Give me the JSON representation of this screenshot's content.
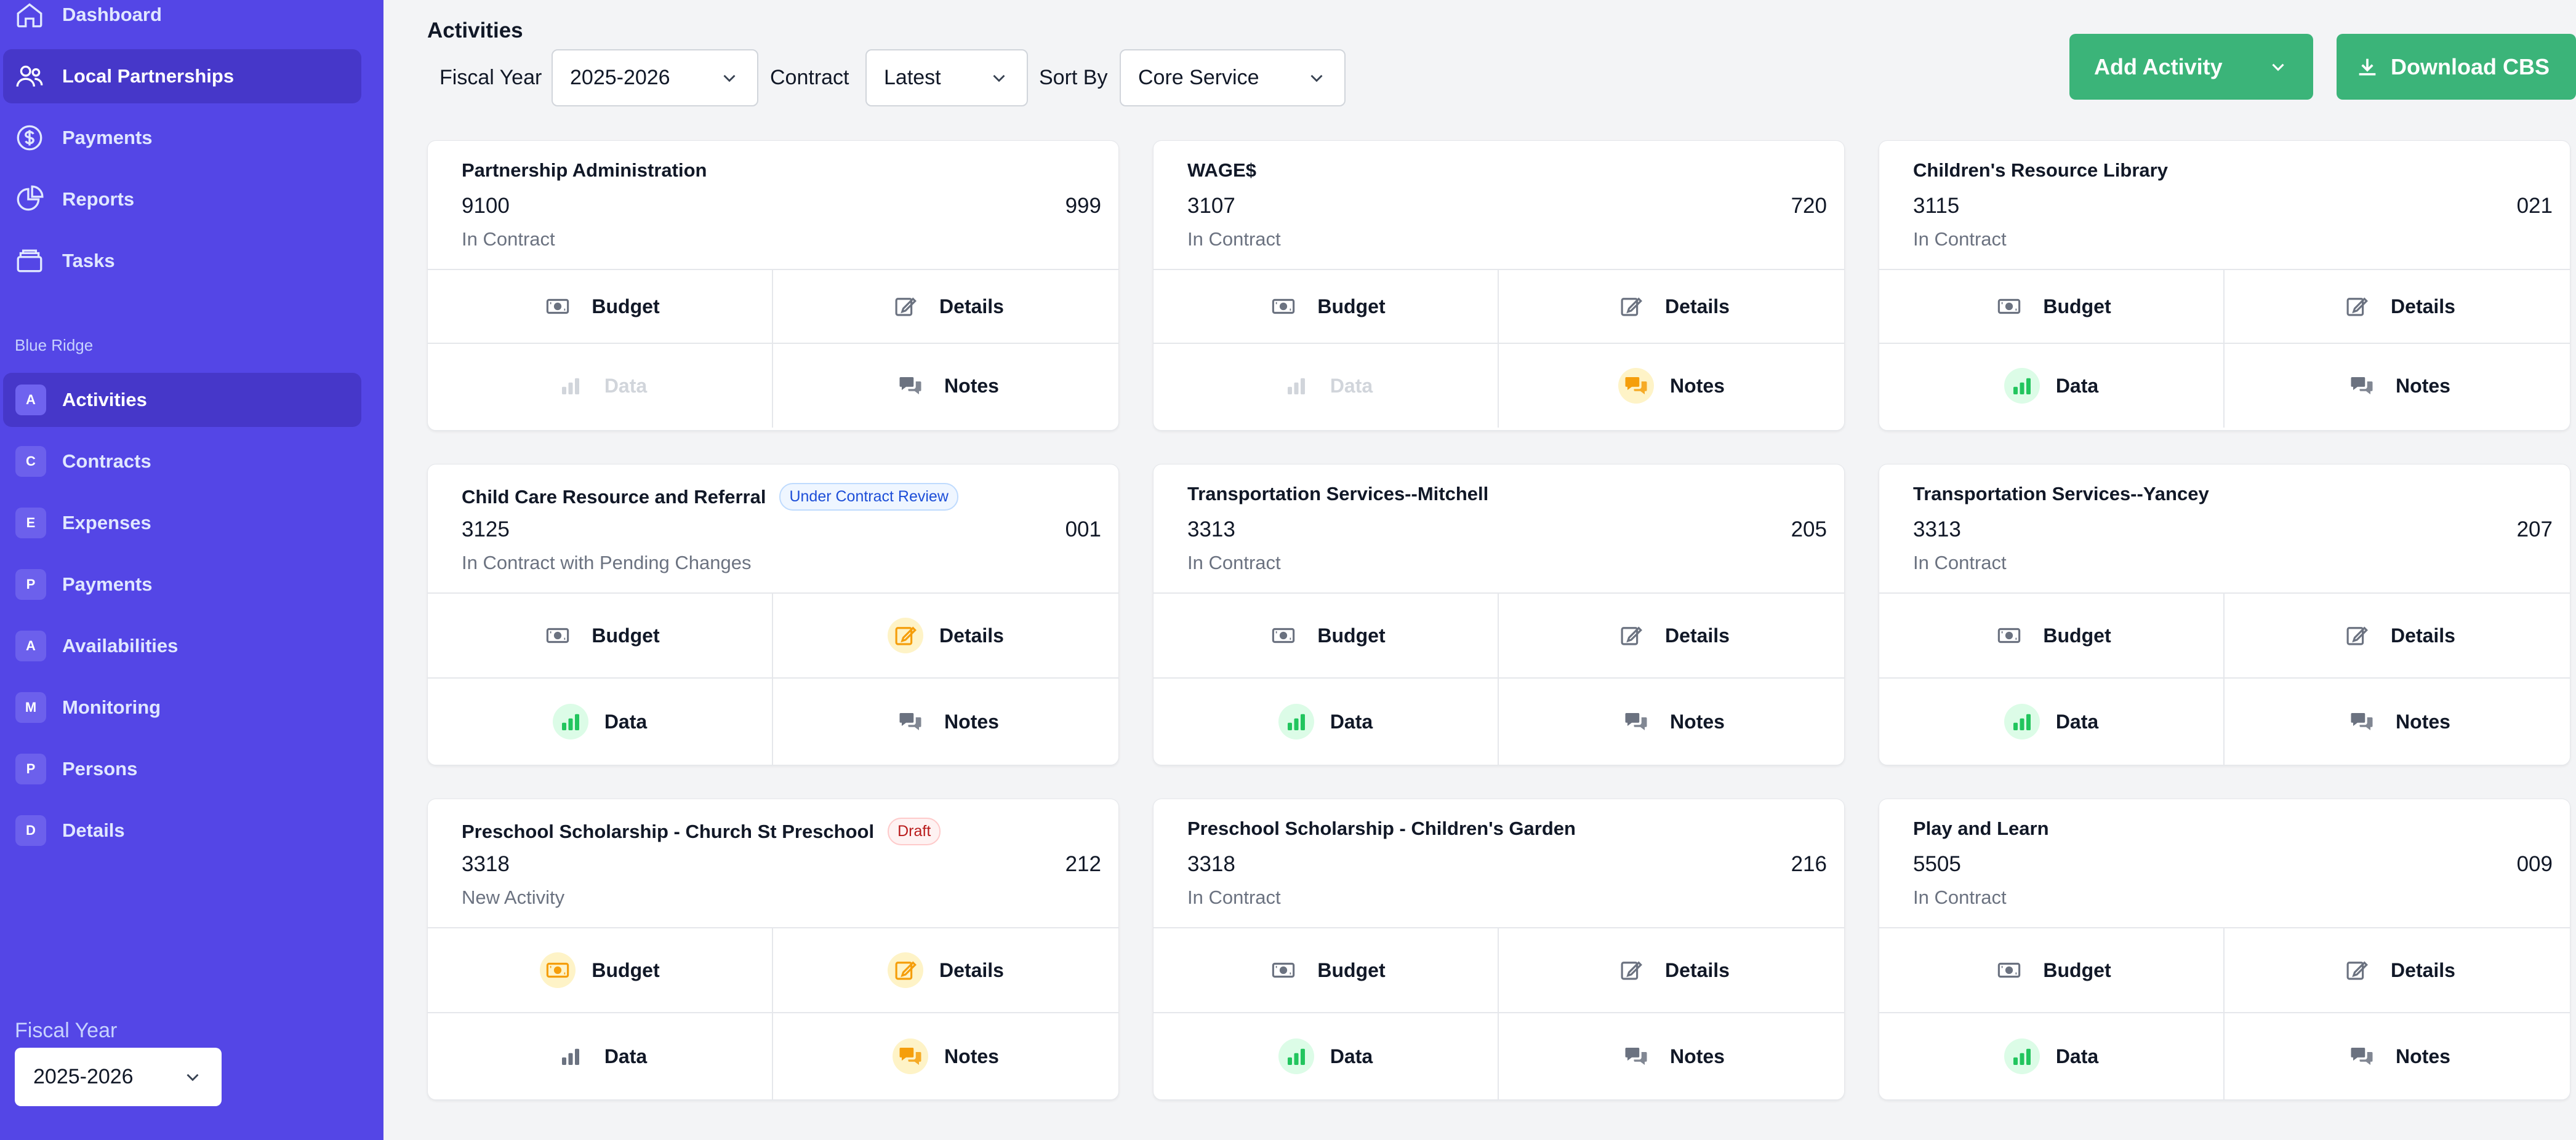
{
  "sidebar": {
    "nav": [
      {
        "label": "Dashboard",
        "icon": "home-icon"
      },
      {
        "label": "Local Partnerships",
        "icon": "users-icon",
        "active": true
      },
      {
        "label": "Payments",
        "icon": "dollar-icon"
      },
      {
        "label": "Reports",
        "icon": "pie-chart-icon"
      },
      {
        "label": "Tasks",
        "icon": "tray-icon"
      }
    ],
    "group_label": "Blue Ridge",
    "sub_items": [
      {
        "letter": "A",
        "label": "Activities",
        "active": true
      },
      {
        "letter": "C",
        "label": "Contracts"
      },
      {
        "letter": "E",
        "label": "Expenses"
      },
      {
        "letter": "P",
        "label": "Payments"
      },
      {
        "letter": "A",
        "label": "Availabilities"
      },
      {
        "letter": "M",
        "label": "Monitoring"
      },
      {
        "letter": "P",
        "label": "Persons"
      },
      {
        "letter": "D",
        "label": "Details"
      }
    ],
    "fiscal_year_label": "Fiscal Year",
    "fiscal_year_value": "2025-2026"
  },
  "header": {
    "title": "Activities",
    "filters": {
      "fiscal_year_label": "Fiscal Year",
      "fiscal_year_value": "2025-2026",
      "contract_label": "Contract",
      "contract_value": "Latest",
      "sort_label": "Sort By",
      "sort_value": "Core Service"
    },
    "add_activity_label": "Add Activity",
    "download_label": "Download CBS"
  },
  "actions": {
    "budget": "Budget",
    "details": "Details",
    "data": "Data",
    "notes": "Notes"
  },
  "cards": [
    {
      "title": "Partnership Administration",
      "code": "9100",
      "number": "999",
      "status": "In Contract",
      "badge": ""
    },
    {
      "title": "WAGE$",
      "code": "3107",
      "number": "720",
      "status": "In Contract",
      "badge": ""
    },
    {
      "title": "Children's Resource Library",
      "code": "3115",
      "number": "021",
      "status": "In Contract",
      "badge": ""
    },
    {
      "title": "Child Care Resource and Referral",
      "code": "3125",
      "number": "001",
      "status": "In Contract with Pending Changes",
      "badge": "Under Contract Review"
    },
    {
      "title": "Transportation Services--Mitchell",
      "code": "3313",
      "number": "205",
      "status": "In Contract",
      "badge": ""
    },
    {
      "title": "Transportation Services--Yancey",
      "code": "3313",
      "number": "207",
      "status": "In Contract",
      "badge": ""
    },
    {
      "title": "Preschool Scholarship - Church St Preschool",
      "code": "3318",
      "number": "212",
      "status": "New Activity",
      "badge": "Draft"
    },
    {
      "title": "Preschool Scholarship - Children's Garden",
      "code": "3318",
      "number": "216",
      "status": "In Contract",
      "badge": ""
    },
    {
      "title": "Play and Learn",
      "code": "5505",
      "number": "009",
      "status": "In Contract",
      "badge": ""
    }
  ]
}
